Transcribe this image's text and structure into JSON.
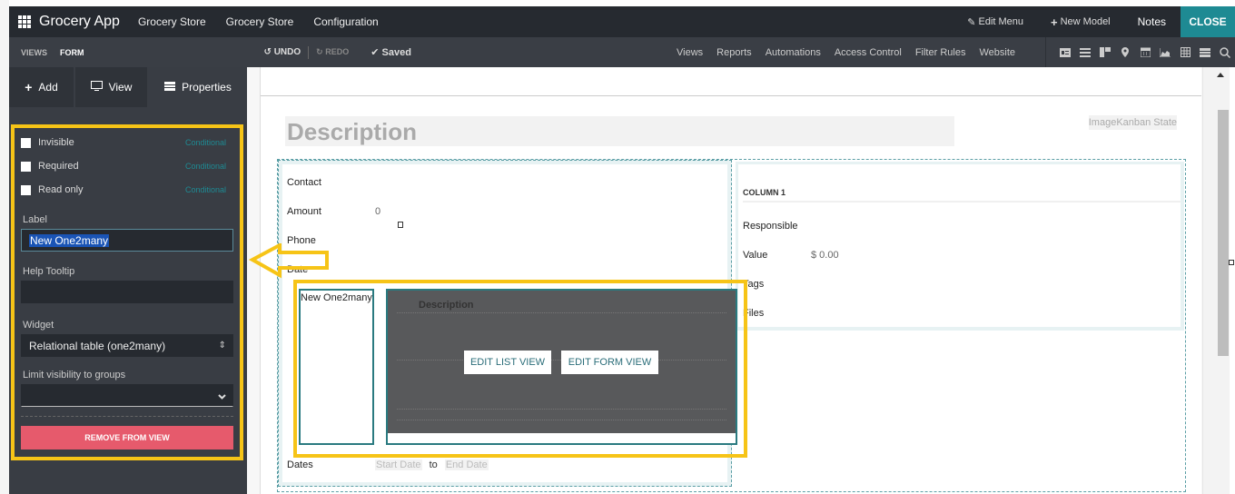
{
  "topbar": {
    "app_title": "Grocery App",
    "menus": [
      "Grocery Store",
      "Grocery Store",
      "Configuration"
    ],
    "edit_menu": "Edit Menu",
    "new_model": "New Model",
    "notes": "Notes",
    "close": "CLOSE",
    "accent_color": "#1e8a93"
  },
  "subbar": {
    "breadcrumbs": [
      "VIEWS",
      "FORM"
    ],
    "undo": "UNDO",
    "redo": "REDO",
    "saved": "Saved",
    "nav": [
      "Views",
      "Reports",
      "Automations",
      "Access Control",
      "Filter Rules",
      "Website"
    ],
    "view_icons": [
      "form-view-icon",
      "list-view-icon",
      "kanban-view-icon",
      "map-view-icon",
      "calendar-view-icon",
      "graph-view-icon",
      "pivot-view-icon",
      "cohort-view-icon",
      "search-view-icon"
    ]
  },
  "sidebar": {
    "tabs": [
      {
        "label": "Add",
        "icon": "plus-icon"
      },
      {
        "label": "View",
        "icon": "monitor-icon"
      },
      {
        "label": "Properties",
        "icon": "properties-icon"
      }
    ],
    "active_tab": "Properties",
    "checkboxes": [
      {
        "label": "Invisible",
        "checked": false,
        "link": "Conditional"
      },
      {
        "label": "Required",
        "checked": false,
        "link": "Conditional"
      },
      {
        "label": "Read only",
        "checked": false,
        "link": "Conditional"
      }
    ],
    "label_field": {
      "label": "Label",
      "value": "New One2many"
    },
    "help_tooltip": {
      "label": "Help Tooltip",
      "value": ""
    },
    "widget": {
      "label": "Widget",
      "value": "Relational table (one2many)"
    },
    "groups": {
      "label": "Limit visibility to groups",
      "value": ""
    },
    "remove_button": "REMOVE FROM VIEW"
  },
  "form": {
    "title_placeholder": "Description",
    "kanban_state": "ImageKanban State",
    "left_fields": [
      {
        "label": "Contact",
        "value": ""
      },
      {
        "label": "Amount",
        "value": "0"
      },
      {
        "label": "Phone",
        "value": ""
      },
      {
        "label": "Date",
        "value": ""
      }
    ],
    "one2many": {
      "label": "New One2many",
      "column": "Description",
      "edit_list": "EDIT LIST VIEW",
      "edit_form": "EDIT FORM VIEW"
    },
    "dates": {
      "label": "Dates",
      "start": "Start Date",
      "to": "to",
      "end": "End Date"
    },
    "right_column": {
      "header": "COLUMN 1",
      "fields": [
        {
          "label": "Responsible",
          "value": ""
        },
        {
          "label": "Value",
          "value": "$ 0.00"
        },
        {
          "label": "Tags",
          "value": ""
        },
        {
          "label": "Files",
          "value": ""
        }
      ]
    }
  }
}
